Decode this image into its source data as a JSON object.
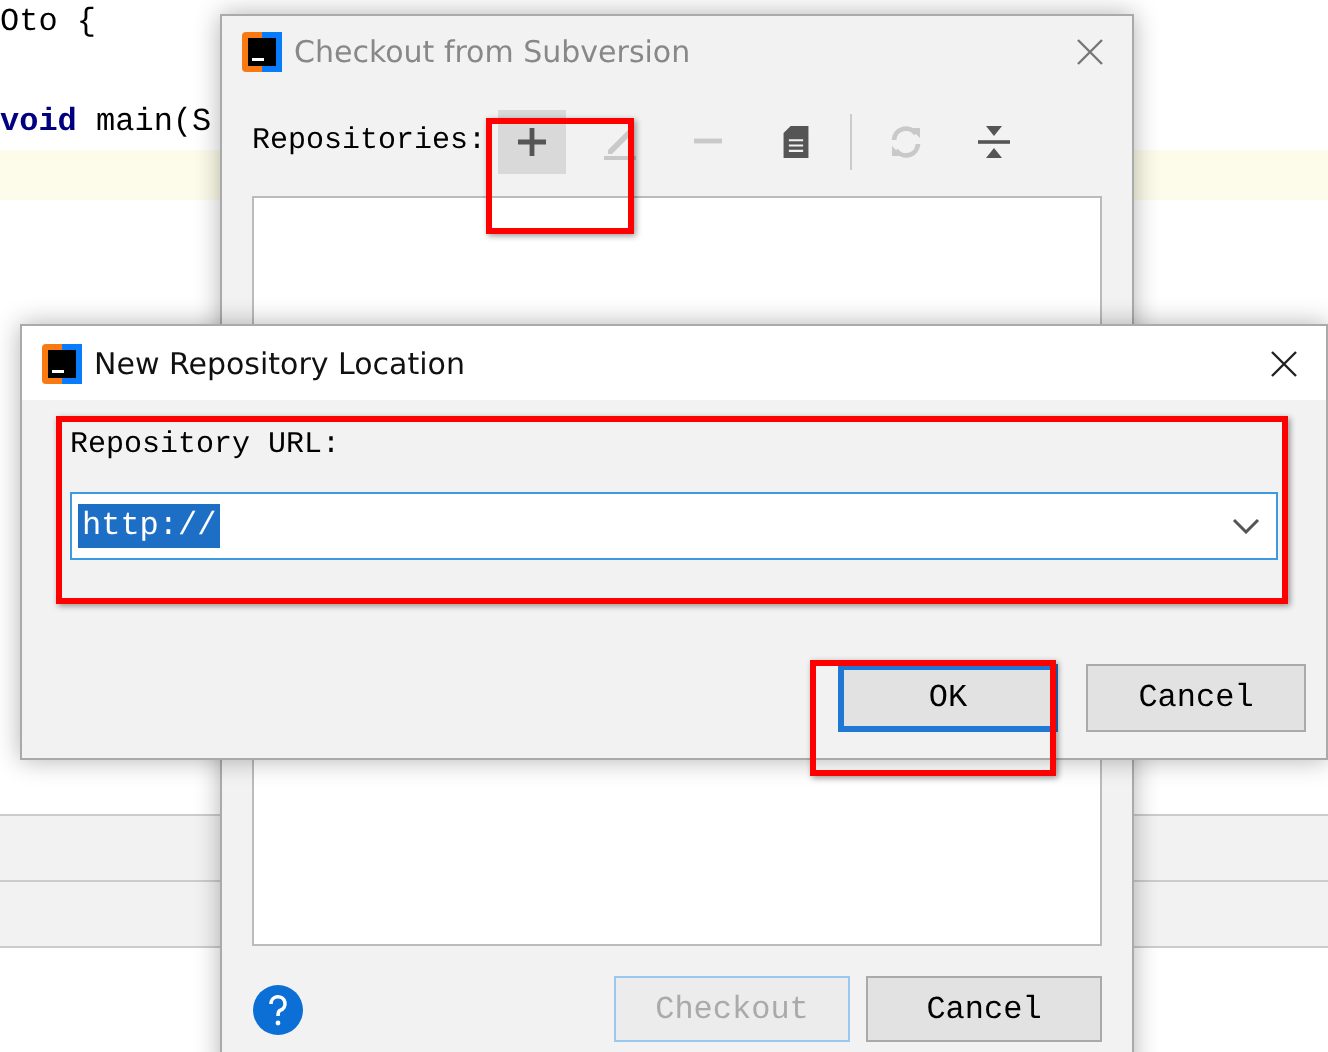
{
  "editor": {
    "lines": [
      {
        "text": "Oto {",
        "highlighted": false
      },
      {
        "highlighted": false
      },
      {
        "text": " **void** main(S",
        "highlighted": false
      },
      {
        "highlighted": true
      }
    ]
  },
  "checkout_dialog": {
    "title": "Checkout from Subversion",
    "repositories_label": "Repositories:",
    "toolbar_groups": [
      [
        {
          "kind": "add",
          "disabled": false,
          "highlighted": true
        },
        {
          "kind": "edit",
          "disabled": true,
          "highlighted": false
        },
        {
          "kind": "remove",
          "disabled": true,
          "highlighted": false
        },
        {
          "kind": "document",
          "disabled": false,
          "highlighted": false
        }
      ],
      [
        {
          "kind": "refresh",
          "disabled": true,
          "highlighted": false
        },
        {
          "kind": "collapse",
          "disabled": false,
          "highlighted": false
        }
      ]
    ],
    "buttons": [
      {
        "label": "Checkout",
        "disabled": true
      },
      {
        "label": "Cancel",
        "disabled": false
      }
    ]
  },
  "new_repository_dialog": {
    "title": "New Repository Location",
    "url_label": "Repository URL:",
    "url_value": "http://",
    "value_selected": true,
    "buttons": [
      {
        "label": "OK",
        "focused": true
      },
      {
        "label": "Cancel",
        "focused": false
      }
    ]
  }
}
